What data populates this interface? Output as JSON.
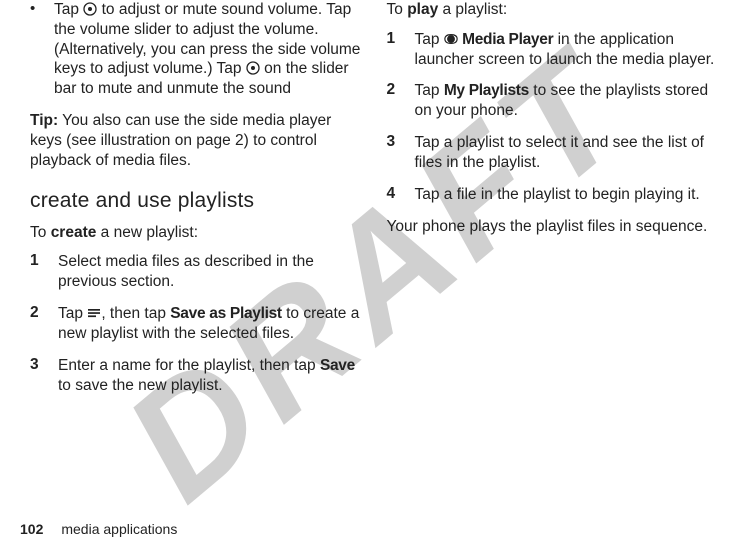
{
  "watermark": "DRAFT",
  "left": {
    "bullet": {
      "pre": "Tap ",
      "icon1": "volume-icon",
      "mid1": " to adjust or mute sound volume. Tap the volume slider to adjust the volume. (Alternatively, you can press the side volume keys to adjust volume.) Tap ",
      "icon2": "volume-icon",
      "post": " on the slider bar to mute and unmute the sound"
    },
    "tip_label": "Tip:",
    "tip_text": " You also can use the side media player keys (see illustration on page 2) to control playback of media files.",
    "heading": "create and use playlists",
    "intro_pre": "To ",
    "intro_bold": "create",
    "intro_post": " a new playlist:",
    "steps": [
      {
        "num": "1",
        "text": "Select media files as described in the previous section."
      },
      {
        "num": "2",
        "pre": "Tap ",
        "icon": "menu-icon",
        "mid": ", then tap ",
        "bold": "Save as Playlist",
        "post": " to create a new playlist with the selected files."
      },
      {
        "num": "3",
        "pre": "Enter a name for the playlist, then tap ",
        "bold": "Save",
        "post": " to save the new playlist."
      }
    ]
  },
  "right": {
    "intro_pre": "To ",
    "intro_bold": "play",
    "intro_post": " a playlist:",
    "steps": [
      {
        "num": "1",
        "pre": "Tap ",
        "icon": "media-player-icon",
        "bold": "Media Player",
        "post": " in the application launcher screen to launch the media player."
      },
      {
        "num": "2",
        "pre": "Tap ",
        "bold": "My Playlists",
        "post": " to see the playlists stored on your phone."
      },
      {
        "num": "3",
        "text": "Tap a playlist to select it and see the list of files in the playlist."
      },
      {
        "num": "4",
        "text": "Tap a file in the playlist to begin playing it."
      }
    ],
    "outro": "Your phone plays the playlist files in sequence."
  },
  "footer": {
    "page": "102",
    "label": "media applications"
  }
}
